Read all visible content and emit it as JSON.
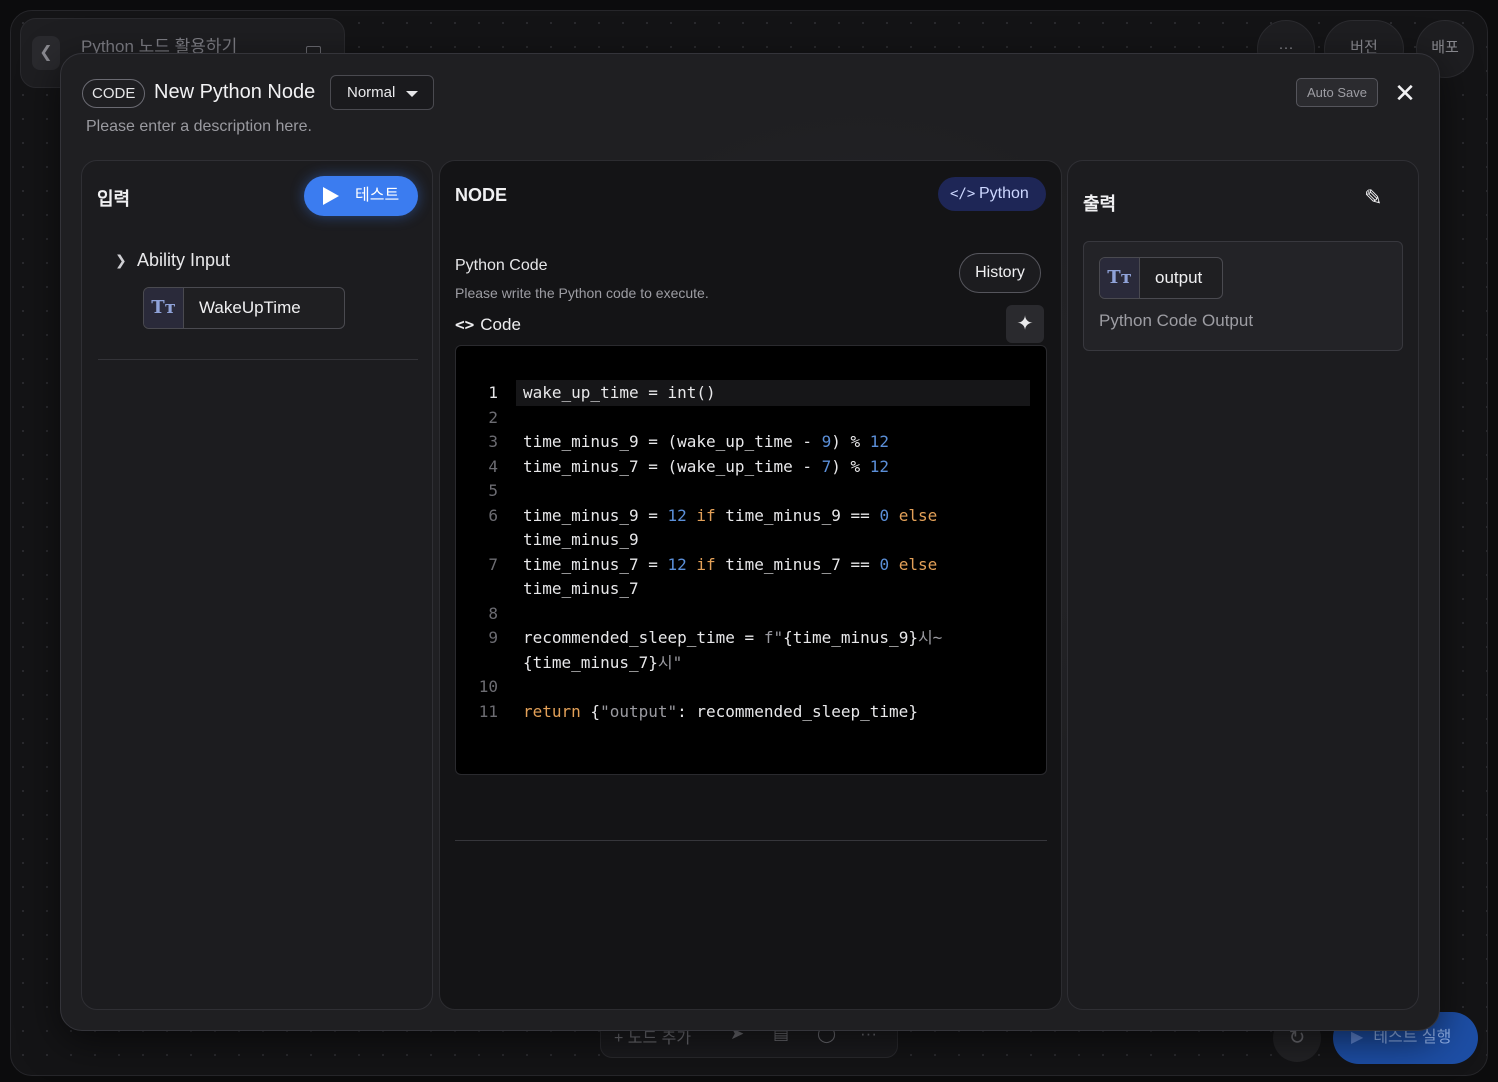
{
  "background": {
    "header_title": "Python 노드 활용하기",
    "top_buttons": {
      "more": "···",
      "version": "버전",
      "deploy": "배포"
    },
    "toolbar": {
      "add_node": "+ 노드 추가",
      "more": "···"
    },
    "run_test": "테스트 실행"
  },
  "modal": {
    "badge": "CODE",
    "title": "New Python Node",
    "mode": "Normal",
    "description": "Please enter a description here.",
    "autosave": "Auto Save",
    "close": "✕"
  },
  "input_panel": {
    "title": "입력",
    "test_button": "테스트",
    "group_label": "Ability Input",
    "variables": [
      {
        "type_icon": "Tт",
        "name": "WakeUpTime"
      }
    ]
  },
  "node_panel": {
    "title": "NODE",
    "language": "Python",
    "field_label": "Python Code",
    "field_help": "Please write the Python code to execute.",
    "history": "History",
    "code_label": "Code",
    "code": [
      {
        "n": "1",
        "text": "wake_up_time = int()"
      },
      {
        "n": "2",
        "text": ""
      },
      {
        "n": "3",
        "text": "time_minus_9 = (wake_up_time - 9) % 12"
      },
      {
        "n": "4",
        "text": "time_minus_7 = (wake_up_time - 7) % 12"
      },
      {
        "n": "5",
        "text": ""
      },
      {
        "n": "6",
        "text": "time_minus_9 = 12 if time_minus_9 == 0 else time_minus_9"
      },
      {
        "n": "7",
        "text": "time_minus_7 = 12 if time_minus_7 == 0 else time_minus_7"
      },
      {
        "n": "8",
        "text": ""
      },
      {
        "n": "9",
        "text": "recommended_sleep_time = f\"{time_minus_9}시~{time_minus_7}시\""
      },
      {
        "n": "10",
        "text": ""
      },
      {
        "n": "11",
        "text": "return {\"output\": recommended_sleep_time}"
      }
    ]
  },
  "output_panel": {
    "title": "출력",
    "variable": {
      "type_icon": "Tт",
      "name": "output"
    },
    "description": "Python Code Output"
  },
  "colors": {
    "accent": "#3b7cf0",
    "python_badge": "#1e2656",
    "keyword": "#e2a058",
    "number": "#5b8fd8"
  },
  "icons": [
    "back-arrow-icon",
    "document-icon",
    "play-icon",
    "chevron-down-icon",
    "text-type-icon",
    "code-brackets-icon",
    "sparkle-icon",
    "pencil-icon",
    "close-icon"
  ]
}
